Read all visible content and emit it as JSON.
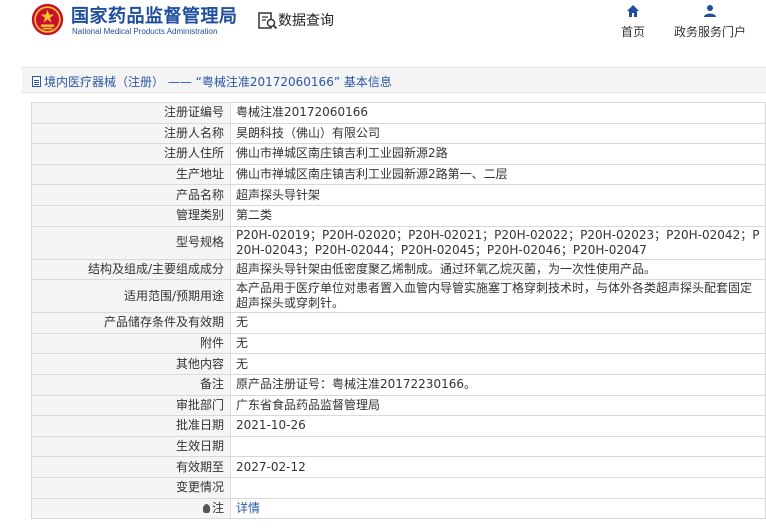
{
  "header": {
    "org_name_cn": "国家药品监督管理局",
    "org_name_en": "National Medical Products Administration",
    "query_label": "数据查询",
    "nav": [
      {
        "label": "首页",
        "icon": "home-icon"
      },
      {
        "label": "政务服务门户",
        "icon": "user-icon"
      }
    ]
  },
  "breadcrumb": {
    "text": "境内医疗器械（注册） —— “粤械注准20172060166” 基本信息"
  },
  "colors": {
    "brand_blue": "#1f4f9c",
    "link_blue": "#2a57a5",
    "emblem_red": "#c8102e",
    "emblem_gold": "#f2c12e"
  },
  "rows": [
    {
      "label": "注册证编号",
      "value": "粤械注准20172060166"
    },
    {
      "label": "注册人名称",
      "value": "昊朗科技（佛山）有限公司"
    },
    {
      "label": "注册人住所",
      "value": "佛山市禅城区南庄镇吉利工业园新源2路"
    },
    {
      "label": "生产地址",
      "value": "佛山市禅城区南庄镇吉利工业园新源2路第一、二层"
    },
    {
      "label": "产品名称",
      "value": "超声探头导针架"
    },
    {
      "label": "管理类别",
      "value": "第二类"
    },
    {
      "label": "型号规格",
      "value": "P20H-02019；P20H-02020；P20H-02021；P20H-02022；P20H-02023；P20H-02042；P20H-02043；P20H-02044；P20H-02045；P20H-02046；P20H-02047"
    },
    {
      "label": "结构及组成/主要组成成分",
      "value": "超声探头导针架由低密度聚乙烯制成。通过环氧乙烷灭菌，为一次性使用产品。"
    },
    {
      "label": "适用范围/预期用途",
      "value": "本产品用于医疗单位对患者置入血管内导管实施塞丁格穿刺技术时，与体外各类超声探头配套固定超声探头或穿刺针。"
    },
    {
      "label": "产品储存条件及有效期",
      "value": "无"
    },
    {
      "label": "附件",
      "value": "无"
    },
    {
      "label": "其他内容",
      "value": "无"
    },
    {
      "label": "备注",
      "value": "原产品注册证号：粤械注准20172230166。"
    },
    {
      "label": "审批部门",
      "value": "广东省食品药品监督管理局"
    },
    {
      "label": "批准日期",
      "value": "2021-10-26"
    },
    {
      "label": "生效日期",
      "value": ""
    },
    {
      "label": "有效期至",
      "value": "2027-02-12"
    },
    {
      "label": "变更情况",
      "value": ""
    },
    {
      "label": "注",
      "value": "详情",
      "icon": "bulb-icon"
    }
  ]
}
